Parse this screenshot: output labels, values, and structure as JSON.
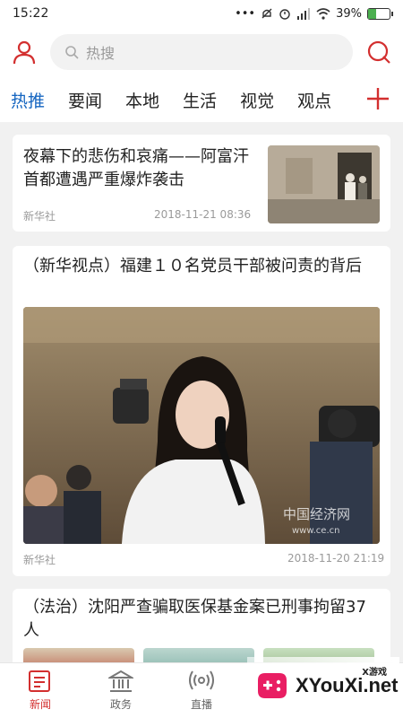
{
  "status": {
    "time": "15:22",
    "battery": "39%",
    "battery_level": 0.39
  },
  "header": {
    "search_placeholder": "热搜"
  },
  "tabs": [
    {
      "label": "热推",
      "active": true
    },
    {
      "label": "要闻"
    },
    {
      "label": "本地"
    },
    {
      "label": "生活"
    },
    {
      "label": "视觉"
    },
    {
      "label": "观点"
    }
  ],
  "articles": [
    {
      "title": "夜幕下的悲伤和哀痛——阿富汗首都遭遇严重爆炸袭击",
      "source": "新华社",
      "date": "2018-11-21 08:36"
    },
    {
      "title": "（新华视点）福建１０名党员干部被问责的背后",
      "source": "新华社",
      "date": "2018-11-20 21:19",
      "image_watermark": "中国经济网",
      "image_watermark_url": "www.ce.cn"
    },
    {
      "title": "（法治）沈阳严查骗取医保基金案已刑事拘留37人"
    }
  ],
  "bottom_nav": [
    {
      "label": "新闻",
      "active": true
    },
    {
      "label": "政务"
    },
    {
      "label": "直播"
    }
  ],
  "watermark": {
    "text": "XYouXi.net",
    "small": "X游戏"
  },
  "colors": {
    "accent_red": "#d32f2f",
    "active_tab_blue": "#1565c0"
  }
}
